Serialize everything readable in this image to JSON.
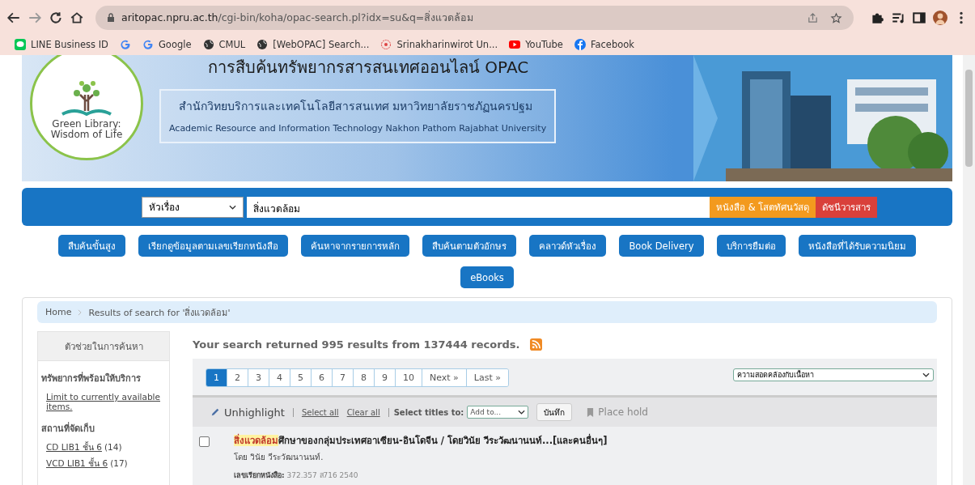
{
  "browser": {
    "url_host": "aritopac.npru.ac.th",
    "url_path": "/cgi-bin/koha/opac-search.pl?idx=su&q=สิ่งแวดล้อม",
    "bookmarks": [
      {
        "kind": "line",
        "label": "LINE Business ID"
      },
      {
        "kind": "google"
      },
      {
        "kind": "google",
        "label": "Google"
      },
      {
        "kind": "globe",
        "label": "CMUL"
      },
      {
        "kind": "globe",
        "label": "[WebOPAC] Search..."
      },
      {
        "kind": "ring",
        "label": "Srinakharinwirot Un..."
      },
      {
        "kind": "youtube",
        "label": "YouTube"
      },
      {
        "kind": "facebook",
        "label": "Facebook"
      }
    ]
  },
  "banner": {
    "heading": "การสืบค้นทรัพยากรสารสนเทศออนไลน์ OPAC",
    "logo_text": [
      "Green Library:",
      "Wisdom of Life"
    ],
    "org_th": "สำนักวิทยบริการและเทคโนโลยีสารสนเทศ มหาวิทยาลัยราชภัฏนครปฐม",
    "org_en": "Academic Resource and Information Technology  Nakhon Pathom Rajabhat University"
  },
  "search": {
    "index": "หัวเรื่อง",
    "query": "สิ่งแวดล้อม",
    "buttons": [
      {
        "label": "หนังสือ & โสตทัศนวัสดุ",
        "color": "#f39a1e"
      },
      {
        "label": "ดัชนีวารสาร",
        "color": "#d9403a"
      }
    ]
  },
  "nav": [
    "สืบค้นขั้นสูง",
    "เรียกดูข้อมูลตามเลขเรียกหนังสือ",
    "ค้นหาจากรายการหลัก",
    "สืบค้นตามตัวอักษร",
    "คลาวด์หัวเรื่อง",
    "Book Delivery",
    "บริการยืมต่อ",
    "หนังสือที่ได้รับความนิยม",
    "eBooks"
  ],
  "breadcrumb": [
    "Home",
    "Results of search for 'สิ่งแวดล้อม'"
  ],
  "sidebar": {
    "title": "ตัวช่วยในการค้นหา",
    "sections": [
      {
        "heading": "ทรัพยากรที่พร้อมให้บริการ",
        "links": [
          {
            "label": "Limit to currently available items."
          }
        ]
      },
      {
        "heading": "สถานที่จัดเก็บ",
        "links": [
          {
            "label": "CD LIB1 ชั้น 6",
            "count": "(14)"
          },
          {
            "label": "VCD LIB1 ชั้น 6",
            "count": "(17)"
          }
        ]
      }
    ]
  },
  "summary": "Your search returned 995 results from 137444 records.",
  "pages": [
    {
      "label": "1",
      "selected": true
    },
    {
      "label": "2",
      "selected": false
    },
    {
      "label": "3",
      "selected": false
    },
    {
      "label": "4",
      "selected": false
    },
    {
      "label": "5",
      "selected": false
    },
    {
      "label": "6",
      "selected": false
    },
    {
      "label": "7",
      "selected": false
    },
    {
      "label": "8",
      "selected": false
    },
    {
      "label": "9",
      "selected": false
    },
    {
      "label": "10",
      "selected": false
    },
    {
      "label": "Next »",
      "selected": false
    },
    {
      "label": "Last »",
      "selected": false
    }
  ],
  "sort": "ความสอดคล้องกับเนื้อหา",
  "toolbar": {
    "unhighlight": "Unhighlight",
    "select_all": "Select all",
    "clear_all": "Clear all",
    "select_titles": "Select titles to:",
    "add_to": "Add to...",
    "save": "บันทึก",
    "place_hold": "Place hold"
  },
  "results": [
    {
      "checked": false,
      "highlight": "สิ่งแวดล้อม",
      "title_rest": "ศึกษาของกลุ่มประเทศอาเซียน-อินโดจีน / โดยวินัย วีระวัฒนานนท์...[และคนอื่นๆ]",
      "author": "โดย วินัย วีระวัฒนานนท์.",
      "call_label": "เลขเรียกหนังสือ:",
      "call_number": "372.357 ส716 2540"
    }
  ]
}
